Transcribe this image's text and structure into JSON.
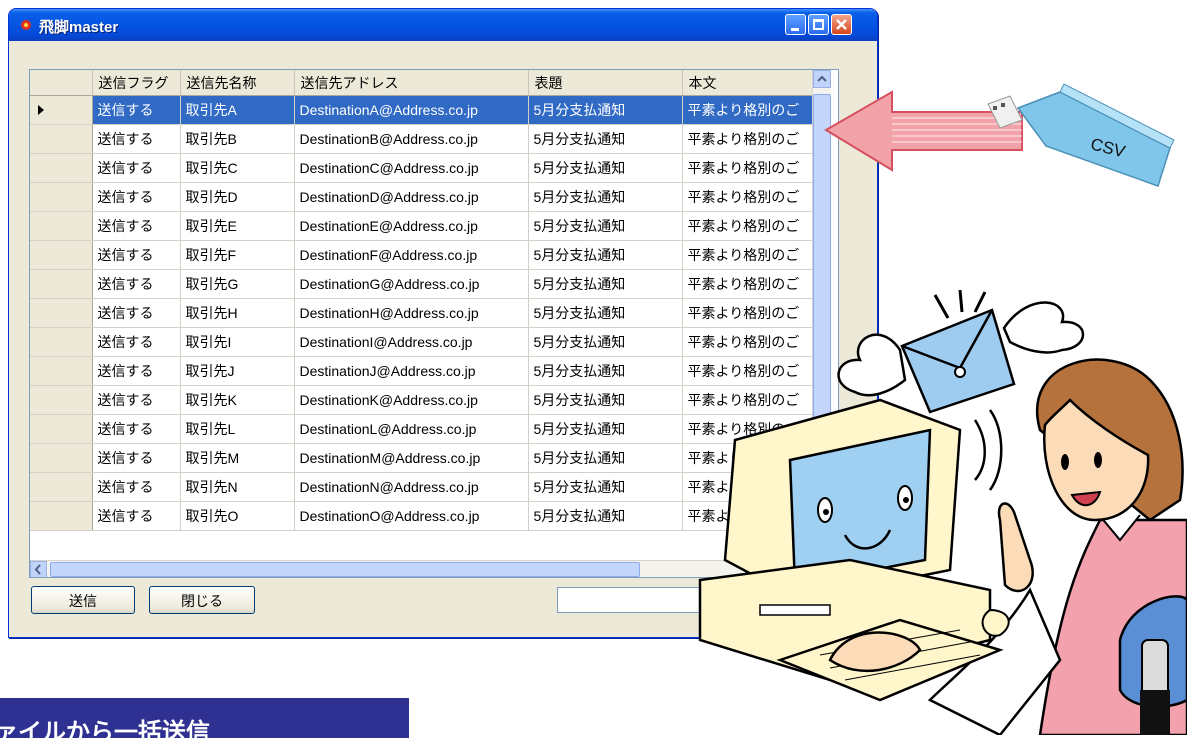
{
  "window": {
    "title": "飛脚master"
  },
  "grid": {
    "columns": [
      "送信フラグ",
      "送信先名称",
      "送信先アドレス",
      "表題",
      "本文"
    ],
    "selected_row": 0,
    "rows": [
      [
        "送信する",
        "取引先A",
        "DestinationA@Address.co.jp",
        "5月分支払通知",
        "平素より格別のご"
      ],
      [
        "送信する",
        "取引先B",
        "DestinationB@Address.co.jp",
        "5月分支払通知",
        "平素より格別のご"
      ],
      [
        "送信する",
        "取引先C",
        "DestinationC@Address.co.jp",
        "5月分支払通知",
        "平素より格別のご"
      ],
      [
        "送信する",
        "取引先D",
        "DestinationD@Address.co.jp",
        "5月分支払通知",
        "平素より格別のご"
      ],
      [
        "送信する",
        "取引先E",
        "DestinationE@Address.co.jp",
        "5月分支払通知",
        "平素より格別のご"
      ],
      [
        "送信する",
        "取引先F",
        "DestinationF@Address.co.jp",
        "5月分支払通知",
        "平素より格別のご"
      ],
      [
        "送信する",
        "取引先G",
        "DestinationG@Address.co.jp",
        "5月分支払通知",
        "平素より格別のご"
      ],
      [
        "送信する",
        "取引先H",
        "DestinationH@Address.co.jp",
        "5月分支払通知",
        "平素より格別のご"
      ],
      [
        "送信する",
        "取引先I",
        "DestinationI@Address.co.jp",
        "5月分支払通知",
        "平素より格別のご"
      ],
      [
        "送信する",
        "取引先J",
        "DestinationJ@Address.co.jp",
        "5月分支払通知",
        "平素より格別のご"
      ],
      [
        "送信する",
        "取引先K",
        "DestinationK@Address.co.jp",
        "5月分支払通知",
        "平素より格別のご"
      ],
      [
        "送信する",
        "取引先L",
        "DestinationL@Address.co.jp",
        "5月分支払通知",
        "平素より格別のご"
      ],
      [
        "送信する",
        "取引先M",
        "DestinationM@Address.co.jp",
        "5月分支払通知",
        "平素より格別のご"
      ],
      [
        "送信する",
        "取引先N",
        "DestinationN@Address.co.jp",
        "5月分支払通知",
        "平素より格別のご"
      ],
      [
        "送信する",
        "取引先O",
        "DestinationO@Address.co.jp",
        "5月分支払通知",
        "平素より格別のご"
      ]
    ]
  },
  "buttons": {
    "send": "送信",
    "close": "閉じる"
  },
  "illustration": {
    "usb_label": "CSV"
  },
  "banner": {
    "text": "ァイルから一括送信"
  },
  "colors": {
    "titlebar": "#0554e3",
    "selection": "#316ac5",
    "arrow": "#e8808a",
    "usb_body": "#7fc6ea",
    "banner": "#2e3191"
  }
}
